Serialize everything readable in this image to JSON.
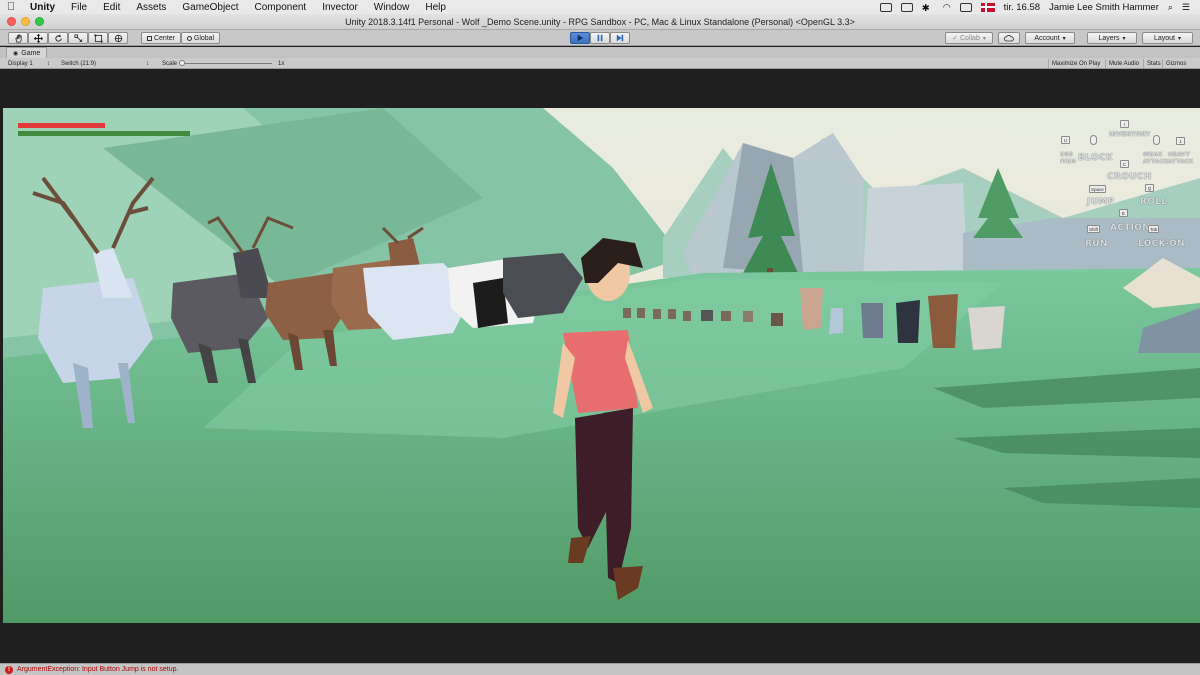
{
  "menubar": {
    "app": "Unity",
    "items": [
      "File",
      "Edit",
      "Assets",
      "GameObject",
      "Component",
      "Invector",
      "Window",
      "Help"
    ],
    "clock": "tir. 16.58",
    "user": "Jamie Lee Smith Hammer"
  },
  "window": {
    "title": "Unity 2018.3.14f1 Personal - Wolf _Demo Scene.unity - RPG Sandbox - PC, Mac & Linux Standalone (Personal) <OpenGL 3.3>"
  },
  "toolbar": {
    "pivot_label": "Center",
    "space_label": "Global",
    "collab_label": "Collab",
    "account_label": "Account",
    "layers_label": "Layers",
    "layout_label": "Layout",
    "accent": "#3d72c0"
  },
  "tab": {
    "label": "Game"
  },
  "gamebar": {
    "display": "Display 1",
    "aspect": "Switch (21:9)",
    "scale_label": "Scale",
    "scale_value": "1x",
    "maximize": "Maximize On Play",
    "mute": "Mute Audio",
    "stats": "Stats",
    "gizmos": "Gizmos"
  },
  "hud": {
    "health_color": "#e03a3a",
    "stamina_color": "#3f8a3f",
    "health_fraction": 0.49,
    "stamina_fraction": 1.0,
    "controls": {
      "inventory": "INVENTORY",
      "use_item": "USE ITEM",
      "block": "BLOCK",
      "weak_attack": "WEAK ATTACK",
      "heavy_attack": "HEAVY ATTACK",
      "crouch": "CROUCH",
      "jump": "JUMP",
      "roll": "ROLL",
      "action": "ACTION",
      "run": "RUN",
      "lock_on": "LOCK-ON"
    },
    "keys": {
      "inventory": "I",
      "use_item": "U",
      "heavy": "1",
      "crouch": "C",
      "jump": "Space",
      "roll": "Q",
      "action": "E",
      "run": "Shift",
      "lock_on": "Tab"
    }
  },
  "console": {
    "message": "ArgumentException: Input Button Jump is not setup."
  }
}
